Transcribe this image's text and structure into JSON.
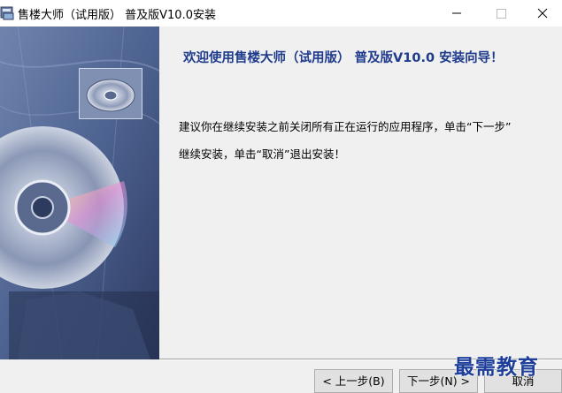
{
  "window": {
    "title": "售楼大师（试用版） 普及版V10.0安装",
    "controls": {
      "minimize_icon": "minimize-icon",
      "maximize_icon": "maximize-icon",
      "close_icon": "close-icon"
    }
  },
  "content": {
    "welcome_heading": "欢迎使用售楼大师（试用版） 普及版V10.0 安装向导！",
    "instruction_line1": "建议你在继续安装之前关闭所有正在运行的应用程序，单击“下一步”",
    "instruction_line2": "继续安装，单击“取消”退出安装！"
  },
  "buttons": {
    "back_label": "< 上一步(B)",
    "next_label": "下一步(N) >",
    "cancel_label": "取消"
  },
  "watermark": {
    "text": "最需教育"
  },
  "colors": {
    "heading": "#1f3b8c",
    "sidebar": "#3b4e79",
    "background": "#f0f0f0",
    "watermark": "#1d3f9a"
  }
}
